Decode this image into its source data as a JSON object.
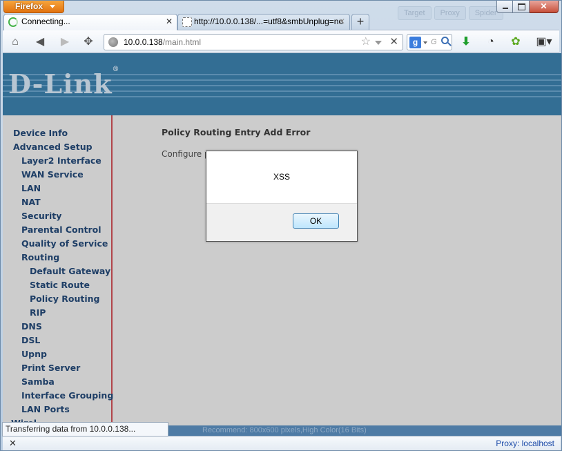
{
  "browser": {
    "app_button_label": "Firefox",
    "ghost_tabs": [
      "Target",
      "Proxy",
      "Spider"
    ],
    "tabs": [
      {
        "title": "Connecting...",
        "close": "✕"
      },
      {
        "title": "http://10.0.0.138/...=utf8&smbUnplug=no",
        "close": "✕"
      }
    ],
    "new_tab_label": "+",
    "url_host": "10.0.0.138",
    "url_path": "/main.html",
    "search_placeholder": "G",
    "status_text": "Transferring data from 10.0.0.138...",
    "statusbar_close": "✕",
    "proxy_label": "Proxy: localhost"
  },
  "router": {
    "logo_text": "D-Link",
    "logo_mark": "®",
    "menu": [
      {
        "label": "Device Info",
        "level": 1
      },
      {
        "label": "Advanced Setup",
        "level": 1
      },
      {
        "label": "Layer2 Interface",
        "level": 2
      },
      {
        "label": "WAN Service",
        "level": 2
      },
      {
        "label": "LAN",
        "level": 2
      },
      {
        "label": "NAT",
        "level": 2
      },
      {
        "label": "Security",
        "level": 2
      },
      {
        "label": "Parental Control",
        "level": 2
      },
      {
        "label": "Quality of Service",
        "level": 2
      },
      {
        "label": "Routing",
        "level": 2
      },
      {
        "label": "Default Gateway",
        "level": 3
      },
      {
        "label": "Static Route",
        "level": 3
      },
      {
        "label": "Policy Routing",
        "level": 3
      },
      {
        "label": "RIP",
        "level": 3
      },
      {
        "label": "DNS",
        "level": 2
      },
      {
        "label": "DSL",
        "level": 2
      },
      {
        "label": "Upnp",
        "level": 2
      },
      {
        "label": "Print Server",
        "level": 2
      },
      {
        "label": "Samba",
        "level": 2
      },
      {
        "label": "Interface Grouping",
        "level": 2
      },
      {
        "label": "LAN Ports",
        "level": 2
      }
    ],
    "menu_partial": "Wirel",
    "heading": "Policy Routing Entry Add Error",
    "body_text": "Configure p",
    "footer_text": "Recommend: 800x600 pixels,High Color(16 Bits)"
  },
  "dialog": {
    "message": "XSS",
    "ok_label": "OK"
  }
}
